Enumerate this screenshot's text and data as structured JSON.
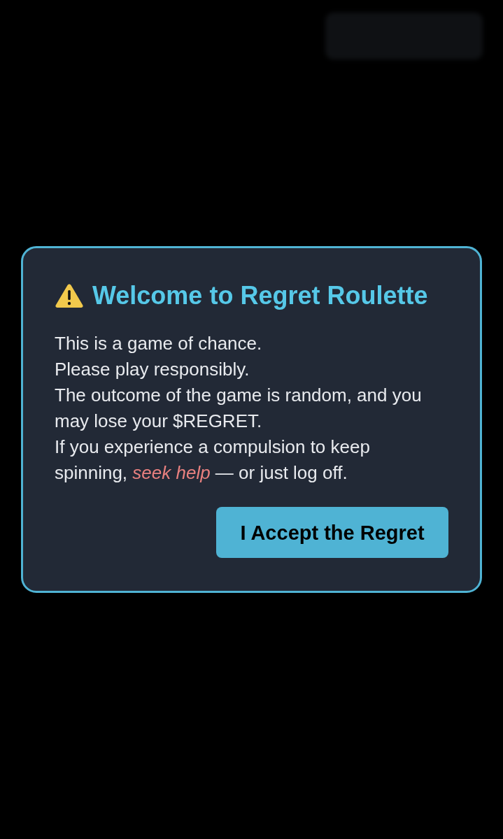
{
  "modal": {
    "title": "Welcome to Regret Roulette",
    "paragraphs": [
      {
        "text": "This is a game of chance."
      },
      {
        "text": "Please play responsibly."
      },
      {
        "text": "The outcome of the game is random, and you may lose your $REGRET."
      },
      {
        "text": "If you experience a compulsion to keep spinning, ",
        "link": "seek help",
        "after": " — or just log off."
      }
    ],
    "button": "I Accept the Regret"
  }
}
